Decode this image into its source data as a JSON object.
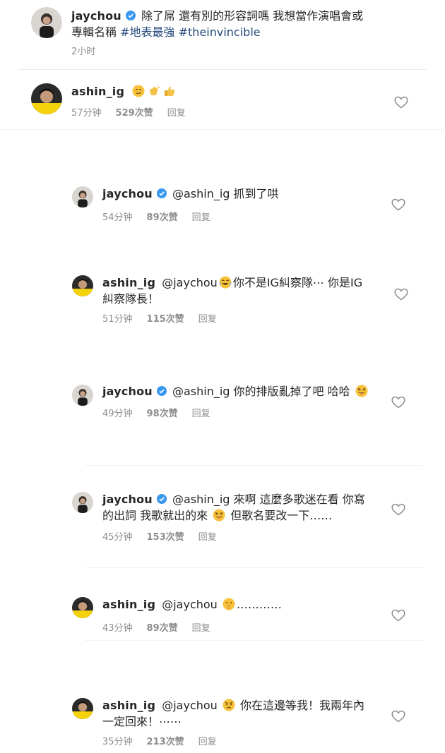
{
  "post": {
    "username": "jaychou",
    "caption": "除了屌 還有別的形容詞嗎 我想當作演唱會或",
    "caption_line2_prefix": "專輯名稱",
    "hashtag1": "#地表最強",
    "hashtag2": "#theinvincible",
    "time": "2小时"
  },
  "comments": [
    {
      "username": "ashin_ig",
      "time": "57分钟",
      "likes": "529次赞",
      "reply": "回复"
    },
    {
      "username": "jaychou",
      "mention": "@ashin_ig",
      "text": "抓到了哄",
      "time": "54分钟",
      "likes": "89次赞",
      "reply": "回复"
    },
    {
      "username": "ashin_ig",
      "mention": "@jaychou",
      "text": "你不是IG糾察隊⋯ 你是IG",
      "text_line2": "糾察隊長！",
      "time": "51分钟",
      "likes": "115次赞",
      "reply": "回复"
    },
    {
      "username": "jaychou",
      "mention": "@ashin_ig",
      "text": "你的排版亂掉了吧 哈哈",
      "time": "49分钟",
      "likes": "98次赞",
      "reply": "回复"
    },
    {
      "username": "jaychou",
      "mention": "@ashin_ig",
      "text": "來啊 這麼多歌迷在看 你寫",
      "text_line2a": "的出詞 我歌就出的來",
      "text_line2b": "但歌名要改一下……",
      "time": "45分钟",
      "likes": "153次赞",
      "reply": "回复"
    },
    {
      "username": "ashin_ig",
      "mention": "@jaychou",
      "text": "…………",
      "time": "43分钟",
      "likes": "89次赞",
      "reply": "回复"
    },
    {
      "username": "ashin_ig",
      "mention": "@jaychou",
      "text": "你在這邊等我！我兩年內",
      "text_line2": "一定回來！⋯⋯",
      "time": "35分钟",
      "likes": "213次赞",
      "reply": "回复"
    }
  ],
  "icons": {
    "verified": "verified-badge-icon",
    "heart": "heart-outline-icon"
  },
  "colors": {
    "text": "#262626",
    "meta": "#8e8e8e",
    "hashtag": "#22487a",
    "verified": "#3897f0"
  }
}
